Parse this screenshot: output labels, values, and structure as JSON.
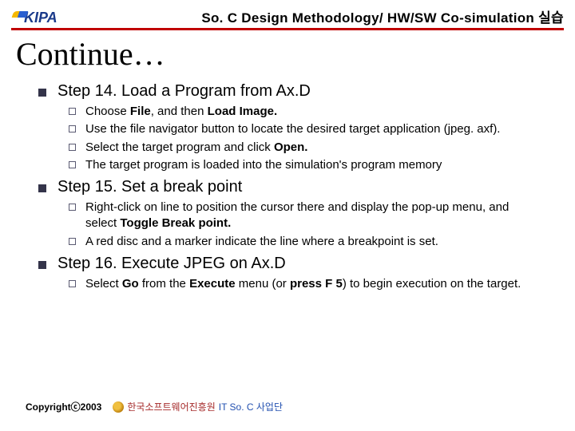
{
  "header": {
    "logo_text": "KIPA",
    "course_title": "So. C Design Methodology/ HW/SW Co-simulation 실습"
  },
  "slide_title": "Continue…",
  "steps": [
    {
      "title": "Step 14. Load a Program from Ax.D",
      "items": [
        {
          "segments": [
            {
              "t": "Choose "
            },
            {
              "t": "File",
              "b": true
            },
            {
              "t": ", and then "
            },
            {
              "t": "Load Image.",
              "b": true
            }
          ]
        },
        {
          "segments": [
            {
              "t": "Use the file navigator button to locate the desired target application (jpeg. axf)."
            }
          ]
        },
        {
          "segments": [
            {
              "t": "Select the target program and click "
            },
            {
              "t": "Open.",
              "b": true
            }
          ]
        },
        {
          "segments": [
            {
              "t": "The target program is loaded into the simulation's program memory"
            }
          ]
        }
      ]
    },
    {
      "title": "Step 15. Set a break point",
      "items": [
        {
          "segments": [
            {
              "t": "Right-click on line to position the cursor there and display the pop-up menu, and select "
            },
            {
              "t": "Toggle Break point.",
              "b": true
            }
          ]
        },
        {
          "segments": [
            {
              "t": "A red disc and a marker indicate the line where a breakpoint is set."
            }
          ]
        }
      ]
    },
    {
      "title": "Step 16. Execute JPEG on Ax.D",
      "items": [
        {
          "segments": [
            {
              "t": "Select "
            },
            {
              "t": "Go",
              "b": true
            },
            {
              "t": " from the "
            },
            {
              "t": "Execute",
              "b": true
            },
            {
              "t": " menu (or "
            },
            {
              "t": "press F 5",
              "b": true
            },
            {
              "t": ") to begin execution on the target."
            }
          ]
        }
      ]
    }
  ],
  "footer": {
    "copyright": "Copyrightⓒ2003",
    "org_ko": "한국소프트웨어진흥원",
    "org_en": "IT So. C 사업단"
  }
}
